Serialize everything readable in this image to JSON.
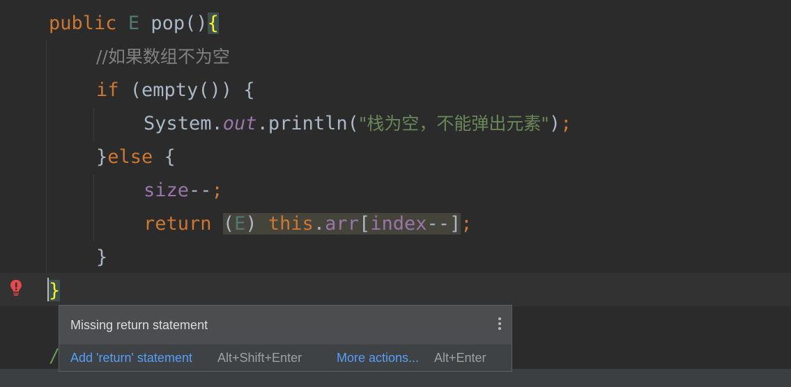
{
  "code": {
    "kw_public": "public",
    "type_e": "E",
    "fn_pop": "pop",
    "parens": "()",
    "open_brace": "{",
    "comment": "//如果数组不为空",
    "kw_if": "if",
    "if_cond": "(empty()) {",
    "system": "System.",
    "out": "out",
    "println_open": ".println(",
    "string": "\"栈为空，不能弹出元素\"",
    "close_paren": ")",
    "semi": ";",
    "else_close": "}",
    "kw_else": "else",
    "else_open": " {",
    "size_field": "size",
    "size_op": "--",
    "kw_return": "return",
    "cast_open": "(",
    "cast_type": "E",
    "cast_close": ")",
    "kw_this": "this",
    "dot": ".",
    "arr_field": "arr",
    "bracket_open": "[",
    "index_field": "index",
    "index_op": "--",
    "bracket_close": "]",
    "inner_close": "}",
    "method_close": "}",
    "partial_comment": "/"
  },
  "popup": {
    "title": "Missing return statement",
    "action_primary": "Add 'return' statement",
    "action_primary_shortcut": "Alt+Shift+Enter",
    "action_more": "More actions...",
    "action_more_shortcut": "Alt+Enter"
  },
  "icons": {
    "error_bulb": "error-bulb-icon",
    "more_menu": "vertical-dots-icon"
  },
  "colors": {
    "background": "#2b2b2b",
    "keyword": "#cc7832",
    "string": "#6a8759",
    "field": "#9876aa",
    "comment": "#808080",
    "link": "#589df6",
    "error": "#e5484d"
  }
}
